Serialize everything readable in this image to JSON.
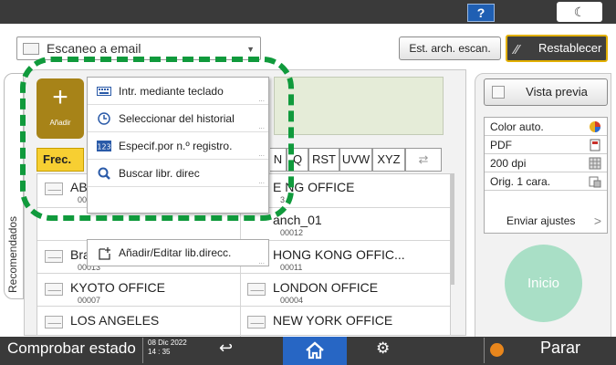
{
  "header": {
    "help_label": "?",
    "night_label": "☾"
  },
  "function_select": {
    "value": "Escaneo a email"
  },
  "toolbar": {
    "scan_settings_label": "Est. arch. escan.",
    "reset_label": "Restablecer"
  },
  "side_tab": {
    "label": "Recomendados"
  },
  "add_button": {
    "plus": "+",
    "label": "Añadir"
  },
  "menu": {
    "items": [
      {
        "label": "Intr. mediante teclado",
        "icon": "keyboard-icon"
      },
      {
        "label": "Seleccionar del historial",
        "icon": "clock-icon"
      },
      {
        "label": "Especif.por n.º registro.",
        "icon": "number-123-icon"
      },
      {
        "label": "Buscar libr. direc",
        "icon": "search-icon"
      }
    ],
    "add_edit_label": "Añadir/Editar lib.direcc.",
    "dots": "..."
  },
  "tabs": {
    "frec": "Frec.",
    "n": "N",
    "q": "Q",
    "rst": "RST",
    "uvw": "UVW",
    "xyz": "XYZ",
    "cycle": "⇄"
  },
  "entries": {
    "left": [
      {
        "name": "AB",
        "reg": "000"
      },
      {
        "name": "",
        "reg": ""
      },
      {
        "name": "Bra",
        "reg": "00013"
      },
      {
        "name": "KYOTO OFFICE",
        "reg": "00007"
      },
      {
        "name": "LOS ANGELES",
        "reg": ""
      }
    ],
    "right": [
      {
        "name": "E NG OFFICE",
        "reg": "3"
      },
      {
        "name": "anch_01",
        "reg": "00012"
      },
      {
        "name": "HONG KONG OFFIC...",
        "reg": "00011"
      },
      {
        "name": "LONDON OFFICE",
        "reg": "00004"
      },
      {
        "name": "NEW YORK OFFICE",
        "reg": ""
      }
    ]
  },
  "right_panel": {
    "preview_label": "Vista previa",
    "settings": [
      {
        "label": "Color auto.",
        "icon": "color-auto-icon"
      },
      {
        "label": "PDF",
        "icon": "pdf-file-icon"
      },
      {
        "label": "200 dpi",
        "icon": "resolution-icon"
      },
      {
        "label": "Orig. 1 cara.",
        "icon": "one-sided-icon"
      }
    ],
    "send_settings_label": "Enviar ajustes",
    "start_label": "Inicio"
  },
  "footer": {
    "check_status_label": "Comprobar estado",
    "date": "08 Dic 2022",
    "time": "14 : 35",
    "stop_label": "Parar"
  },
  "colors": {
    "highlight": "#109a3c",
    "tab_active": "#f7cf32",
    "add_button": "#a78318",
    "home": "#2766c4",
    "start": "#a9dfc6"
  }
}
